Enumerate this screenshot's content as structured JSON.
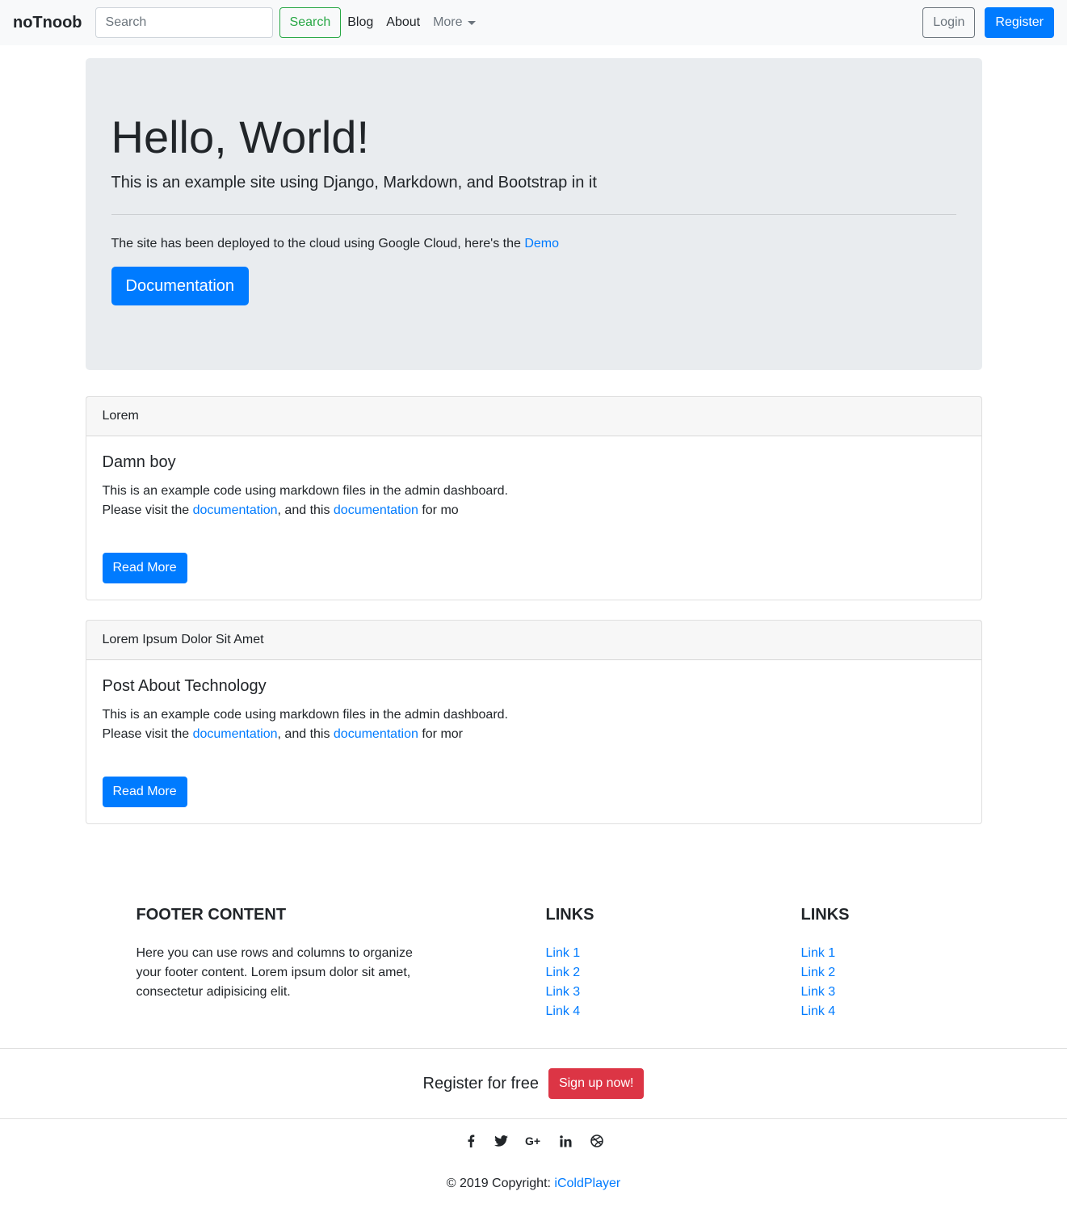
{
  "nav": {
    "brand": "noTnoob",
    "search_placeholder": "Search",
    "search_button": "Search",
    "links": [
      "Blog",
      "About"
    ],
    "more": "More",
    "login": "Login",
    "register": "Register"
  },
  "hero": {
    "title": "Hello, World!",
    "lead": "This is an example site using Django, Markdown, and Bootstrap in it",
    "deploy_text": "The site has been deployed to the cloud using Google Cloud, here's the ",
    "demo_link": "Demo",
    "doc_button": "Documentation"
  },
  "posts": [
    {
      "header": "Lorem",
      "title": "Damn boy",
      "line1": "This is an example code using markdown files in the admin dashboard.",
      "line2_prefix": "Please visit the ",
      "link1": "documentation",
      "middle": ", and this ",
      "link2": "documentation",
      "suffix": " for mo",
      "button": "Read More"
    },
    {
      "header": "Lorem Ipsum Dolor Sit Amet",
      "title": "Post About Technology",
      "line1": "This is an example code using markdown files in the admin dashboard.",
      "line2_prefix": "Please visit the ",
      "link1": "documentation",
      "middle": ", and this ",
      "link2": "documentation",
      "suffix": " for mor",
      "button": "Read More"
    }
  ],
  "footer": {
    "content_title": "FOOTER CONTENT",
    "content_text": "Here you can use rows and columns to organize your footer content. Lorem ipsum dolor sit amet, consectetur adipisicing elit.",
    "links_title_1": "LINKS",
    "links_title_2": "LINKS",
    "links_1": [
      "Link 1",
      "Link 2",
      "Link 3",
      "Link 4"
    ],
    "links_2": [
      "Link 1",
      "Link 2",
      "Link 3",
      "Link 4"
    ],
    "signup_text": "Register for free",
    "signup_button": "Sign up now!",
    "social_icons": [
      "facebook-icon",
      "twitter-icon",
      "google-plus-icon",
      "linkedin-icon",
      "dribbble-icon"
    ],
    "copyright_prefix": "© 2019 Copyright: ",
    "copyright_link": "iColdPlayer"
  }
}
